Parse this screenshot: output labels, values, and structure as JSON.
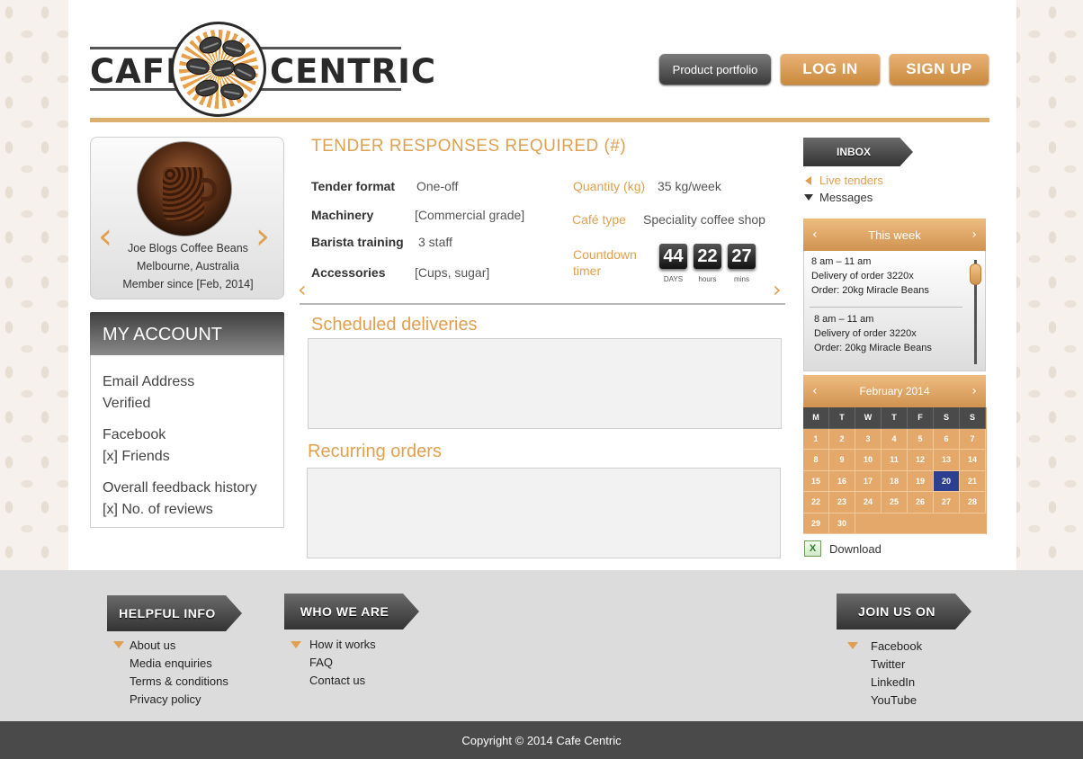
{
  "brand": {
    "word_left": "CAFE",
    "word_right": "CENTRIC"
  },
  "nav": {
    "portfolio": "Product portfolio",
    "login": "LOG IN",
    "signup": "SIGN UP"
  },
  "profile": {
    "name": "Joe Blogs Coffee Beans",
    "location": "Melbourne, Australia",
    "member_since": "Member since [Feb, 2014]"
  },
  "account": {
    "title": "MY ACCOUNT",
    "email_label": "Email Address",
    "email_status": "Verified",
    "facebook_label": "Facebook",
    "facebook_value": "[x] Friends",
    "feedback_label": "Overall feedback history",
    "feedback_value": "[x] No. of reviews"
  },
  "tender": {
    "title": "TENDER RESPONSES REQUIRED (#)",
    "format_label": "Tender format",
    "format_value": "One-off",
    "machinery_label": "Machinery",
    "machinery_value": "[Commercial grade]",
    "barista_label": "Barista training",
    "barista_value": "3 staff",
    "accessories_label": "Accessories",
    "accessories_value": "[Cups, sugar]",
    "quantity_label": "Quantity (kg)",
    "quantity_value": "35 kg/week",
    "cafe_label": "Café type",
    "cafe_value": "Speciality coffee shop",
    "countdown_label_1": "Countdown",
    "countdown_label_2": "timer",
    "days": "44",
    "hours": "22",
    "mins": "27",
    "days_unit": "DAYS",
    "hours_unit": "hours",
    "mins_unit": "mins"
  },
  "sections": {
    "scheduled": "Scheduled deliveries",
    "recurring": "Recurring orders"
  },
  "inbox": {
    "tab": "INBOX",
    "live_tenders": "Live tenders",
    "messages": "Messages"
  },
  "week": {
    "title": "This week",
    "entries": [
      {
        "time": "8 am – 11 am",
        "line1": "Delivery of order 3220x",
        "line2": "Order: 20kg Miracle Beans"
      },
      {
        "time": "8 am – 11 am",
        "line1": "Delivery of order 3220x",
        "line2": "Order: 20kg Miracle Beans"
      }
    ]
  },
  "calendar": {
    "title": "February 2014",
    "dow": [
      "M",
      "T",
      "W",
      "T",
      "F",
      "S",
      "S"
    ],
    "days": [
      "1",
      "2",
      "3",
      "4",
      "5",
      "6",
      "7",
      "8",
      "9",
      "10",
      "11",
      "12",
      "13",
      "14",
      "15",
      "16",
      "17",
      "18",
      "19",
      "20",
      "21",
      "22",
      "23",
      "24",
      "25",
      "26",
      "27",
      "28",
      "29",
      "30"
    ],
    "selected": "20"
  },
  "download": {
    "label": "Download",
    "icon": "excel-icon"
  },
  "footer": {
    "helpful": {
      "title": "HELPFUL INFO",
      "items": [
        "About us",
        "Media enquiries",
        "Terms & conditions",
        "Privacy policy"
      ]
    },
    "who": {
      "title": "WHO WE ARE",
      "items": [
        "How it works",
        "FAQ",
        "Contact us"
      ]
    },
    "join": {
      "title": "JOIN US ON",
      "items": [
        "Facebook",
        "Twitter",
        "LinkedIn",
        "YouTube"
      ]
    }
  },
  "copyright": "Copyright © 2014 Cafe Centric",
  "colors": {
    "accent": "#e0a050",
    "dark": "#4a4a4a",
    "selected_day": "#2e3f8f"
  }
}
